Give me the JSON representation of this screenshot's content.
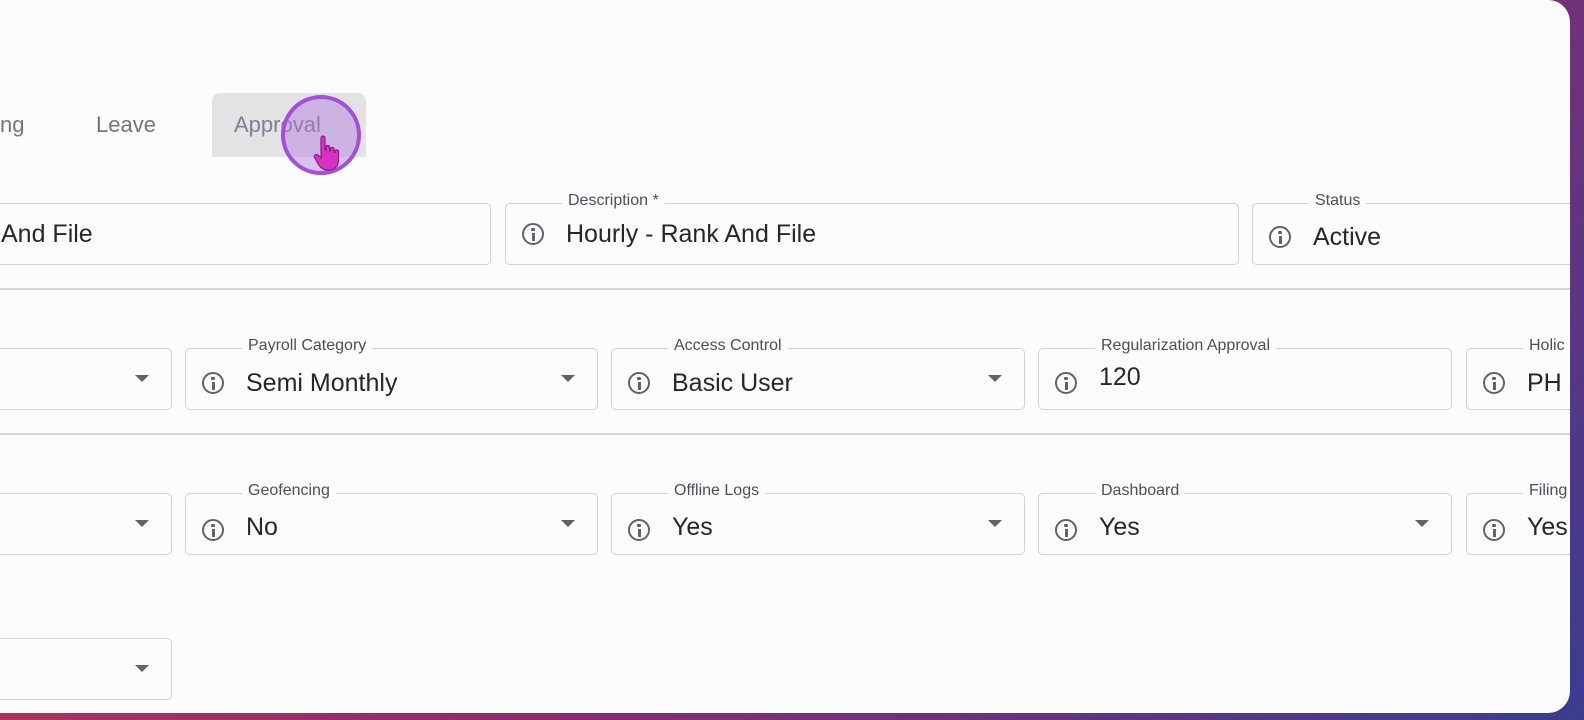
{
  "tabs": [
    {
      "label": "ng",
      "active": false
    },
    {
      "label": "Leave",
      "active": false
    },
    {
      "label": "Approval",
      "active": true
    }
  ],
  "row1": {
    "name": {
      "value": "And File"
    },
    "description": {
      "label": "Description *",
      "value": "Hourly - Rank And File"
    },
    "status": {
      "label": "Status",
      "value": "Active"
    }
  },
  "row2": {
    "first": {
      "value": ""
    },
    "payroll_category": {
      "label": "Payroll Category",
      "value": "Semi Monthly"
    },
    "access_control": {
      "label": "Access Control",
      "value": "Basic User"
    },
    "regularization_approval": {
      "label": "Regularization Approval",
      "value": "120"
    },
    "holiday": {
      "label": "Holic",
      "value": "PH"
    }
  },
  "row3": {
    "first": {
      "value": ""
    },
    "geofencing": {
      "label": "Geofencing",
      "value": "No"
    },
    "offline_logs": {
      "label": "Offline Logs",
      "value": "Yes"
    },
    "dashboard": {
      "label": "Dashboard",
      "value": "Yes"
    },
    "filing": {
      "label": "Filing",
      "value": "Yes"
    }
  },
  "row4": {
    "first": {
      "value": ""
    }
  },
  "colors": {
    "accent_cursor": "#a24fe0",
    "cursor_hand": "#d633c4",
    "border": "#cfd2d7"
  }
}
